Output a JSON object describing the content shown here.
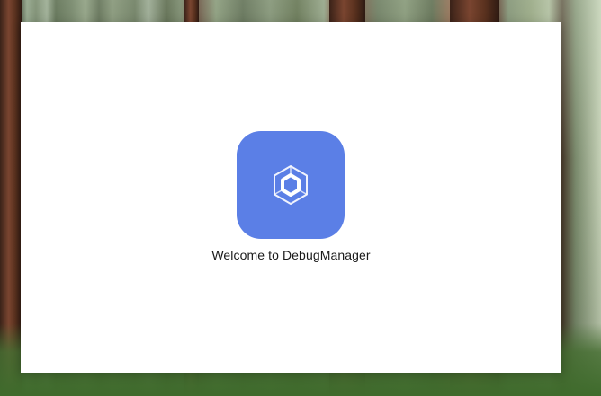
{
  "desktop": {
    "wallpaper": "forest-wallpaper"
  },
  "window": {
    "background": "#ffffff",
    "app_icon": {
      "name": "cube-hexagon-icon",
      "color": "#5b7fe6"
    },
    "welcome_text": "Welcome to DebugManager"
  }
}
